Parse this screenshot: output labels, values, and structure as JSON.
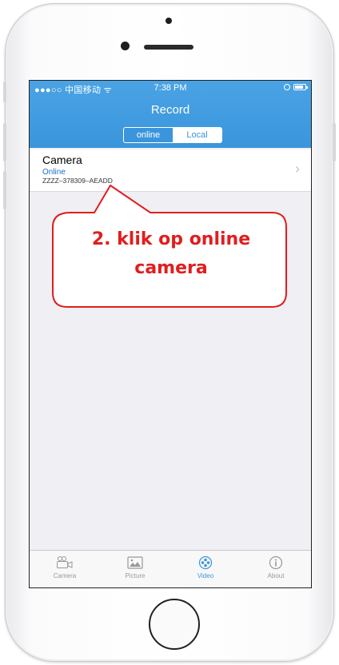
{
  "status_bar": {
    "carrier": "●●●○○ 中国移动 ᯤ",
    "time": "7:38 PM"
  },
  "nav": {
    "title": "Record",
    "segments": [
      {
        "label": "online",
        "active": true
      },
      {
        "label": "Local",
        "active": false
      }
    ]
  },
  "camera_row": {
    "name": "Camera",
    "status": "Online",
    "device_id": "ZZZZ–378309–AEADD",
    "chevron": "›"
  },
  "annotation": {
    "line1": "2. klik op online",
    "line2": "camera",
    "color": "#e01e1e"
  },
  "tabbar": {
    "items": [
      {
        "label": "Camera",
        "icon": "camera-icon",
        "active": false
      },
      {
        "label": "Picture",
        "icon": "picture-icon",
        "active": false
      },
      {
        "label": "Video",
        "icon": "video-reel-icon",
        "active": true
      },
      {
        "label": "About",
        "icon": "info-icon",
        "active": false
      }
    ]
  },
  "colors": {
    "accent": "#3a95dc",
    "background": "#efeff4",
    "status_text": "#1a6ec9"
  }
}
